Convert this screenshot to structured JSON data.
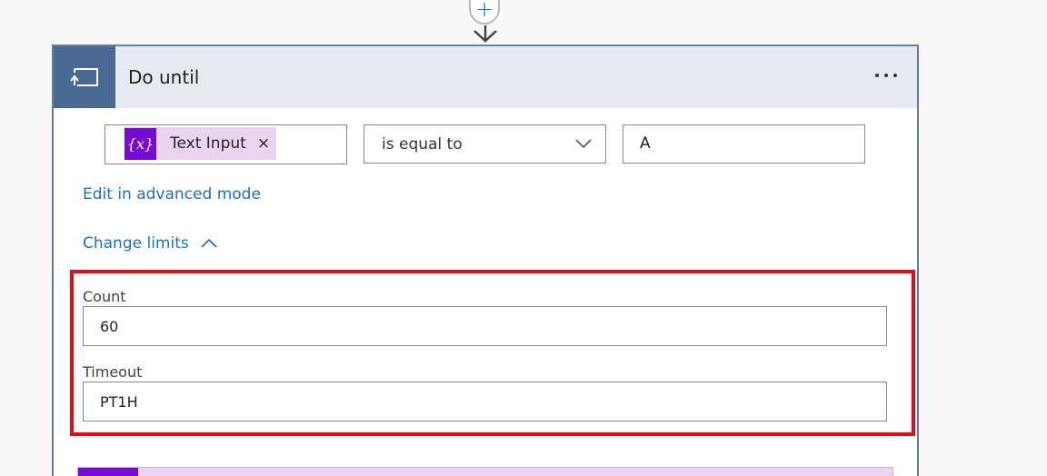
{
  "connector": {
    "add_icon": "plus-icon",
    "arrow_icon": "arrow-down-icon"
  },
  "card": {
    "title": "Do until",
    "header_icon": "loop-icon",
    "more_icon": "more-horizontal-icon",
    "header_icon_bg": "#486991",
    "header_bg": "#e6e9f0"
  },
  "condition": {
    "token": {
      "icon_text": "{x}",
      "label": "Text Input",
      "close": "×",
      "color": "#770bd6",
      "bg": "#ead4f1"
    },
    "operator": "is equal to",
    "value": "A"
  },
  "links": {
    "advanced": "Edit in advanced mode",
    "limits": "Change limits"
  },
  "limits": {
    "count_label": "Count",
    "count_value": "60",
    "timeout_label": "Timeout",
    "timeout_value": "PT1H"
  },
  "colors": {
    "link": "#1f6fc5",
    "highlight": "#e40b14",
    "card_border": "#5f7fa8"
  }
}
